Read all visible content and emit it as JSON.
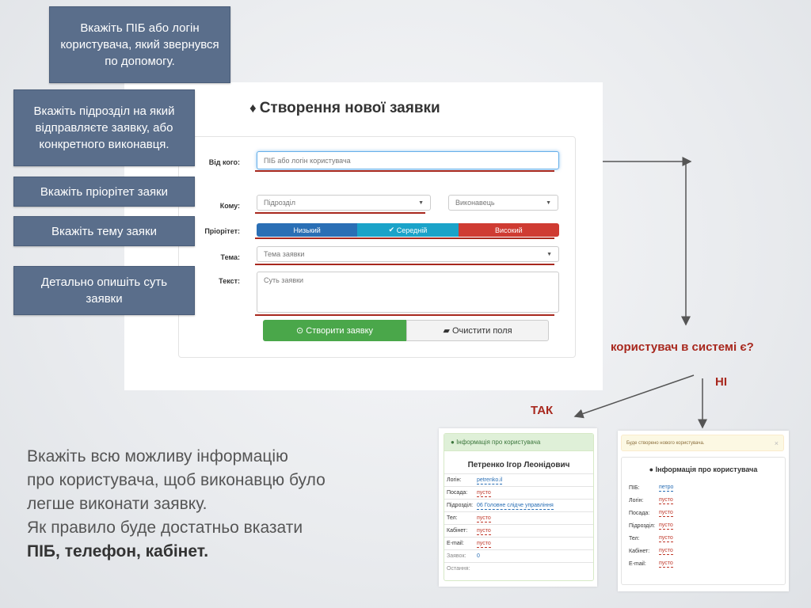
{
  "form": {
    "title": "Створення нової заявки",
    "from_label": "Від кого:",
    "from_placeholder": "ПІБ або логін користувача",
    "to_label": "Кому:",
    "department_placeholder": "Підрозділ",
    "executor_placeholder": "Виконавець",
    "priority_label": "Пріорітет:",
    "priorities": [
      "Низький",
      "Середній",
      "Високий"
    ],
    "priority_selected": "Середній",
    "subject_label": "Тема:",
    "subject_placeholder": "Тема заявки",
    "text_label": "Текст:",
    "text_placeholder": "Суть заявки",
    "create_button": "Створити заявку",
    "clear_button": "Очистити поля"
  },
  "callouts": {
    "user": "Вкажіть ПІБ або логін користувача, який звернувся по допомогу.",
    "department": "Вкажіть підрозділ на який відправляєте заявку, або конкретного виконавця.",
    "priority": "Вкажіть пріорітет заяки",
    "subject": "Вкажіть тему заяки",
    "text": "Детально опишіть суть заявки"
  },
  "flow": {
    "question": "користувач в системі є?",
    "no": "НІ",
    "yes": "ТАК"
  },
  "instructions": {
    "lines": [
      "Вкажіть всю можливу інформацію",
      "про користувача, щоб виконавцю було",
      "легше виконати заявку.",
      "Як правило буде достатньо вказати"
    ],
    "emphasis": "ПІБ, телефон, кабінет."
  },
  "card_existing": {
    "header": "Інформація про користувача",
    "name": "Петренко Ігор Леонідович",
    "rows": [
      {
        "k": "Логін:",
        "v": "petrenko.il"
      },
      {
        "k": "Посада:",
        "v": "пусто"
      },
      {
        "k": "Підрозділ:",
        "v": "06 Головне слідче управління"
      },
      {
        "k": "Тел:",
        "v": "пусто"
      },
      {
        "k": "Кабінет:",
        "v": "пусто"
      },
      {
        "k": "E-mail:",
        "v": "пусто"
      },
      {
        "k": "Заявок:",
        "v": "0"
      },
      {
        "k": "Остання:",
        "v": ""
      }
    ]
  },
  "card_new": {
    "alert": "Буде створено нового користувача.",
    "close": "×",
    "header": "Інформація про користувача",
    "rows": [
      {
        "k": "ПІБ:",
        "v": "петро"
      },
      {
        "k": "Логін:",
        "v": "пусто"
      },
      {
        "k": "Посада:",
        "v": "пусто"
      },
      {
        "k": "Підрозділ:",
        "v": "пусто"
      },
      {
        "k": "Тел:",
        "v": "пусто"
      },
      {
        "k": "Кабінет:",
        "v": "пусто"
      },
      {
        "k": "E-mail:",
        "v": "пусто"
      }
    ]
  },
  "colors": {
    "callout": "#5a6e8b",
    "accent_red": "#a8281e",
    "priority_low": "#2a6fb5",
    "priority_mid": "#1aa3c9",
    "priority_high": "#cf3b32",
    "create": "#4aa74a"
  },
  "icons": {
    "title": "tag-icon",
    "selected_priority": "check-icon",
    "create": "circle-check-icon",
    "clear": "eraser-icon",
    "card": "user-icon"
  }
}
